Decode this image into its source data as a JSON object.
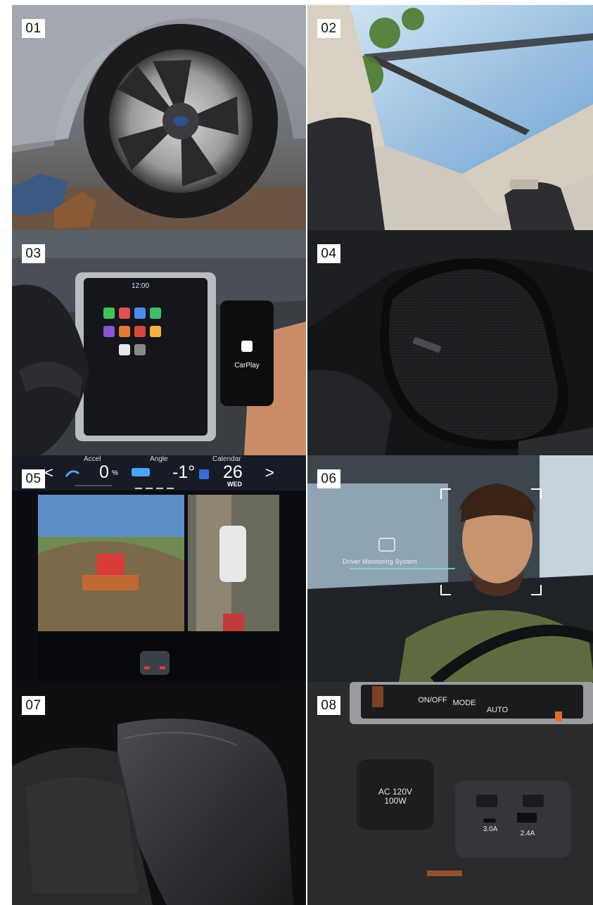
{
  "tiles": [
    {
      "number": "01",
      "icon": "alloy-wheel"
    },
    {
      "number": "02",
      "icon": "panoramic-sunroof"
    },
    {
      "number": "03",
      "icon": "infotainment-carplay",
      "screen_time": "12:00",
      "phone_label": "CarPlay"
    },
    {
      "number": "04",
      "icon": "door-speaker"
    },
    {
      "number": "05",
      "icon": "surround-view-camera",
      "hud": {
        "accel_label": "Accel",
        "angle_label": "Angle",
        "calendar_label": "Calendar",
        "accel_value": "0",
        "accel_unit": "%",
        "angle_value": "-1°",
        "day_value": "26",
        "weekday": "WED",
        "prev": "<",
        "next": ">"
      }
    },
    {
      "number": "06",
      "icon": "driver-monitoring",
      "system_label": "Driver Monitoring System"
    },
    {
      "number": "07",
      "icon": "leather-armrest"
    },
    {
      "number": "08",
      "icon": "power-outlets",
      "buttons": [
        "ON/OFF",
        "MODE",
        "AUTO"
      ],
      "outlet_label": "AC 120V",
      "outlet_power": "100W",
      "usb_c": "3.0A",
      "usb_a": "2.4A"
    }
  ],
  "colors": {
    "badge_bg": "#ffffff",
    "badge_text": "#111111"
  }
}
